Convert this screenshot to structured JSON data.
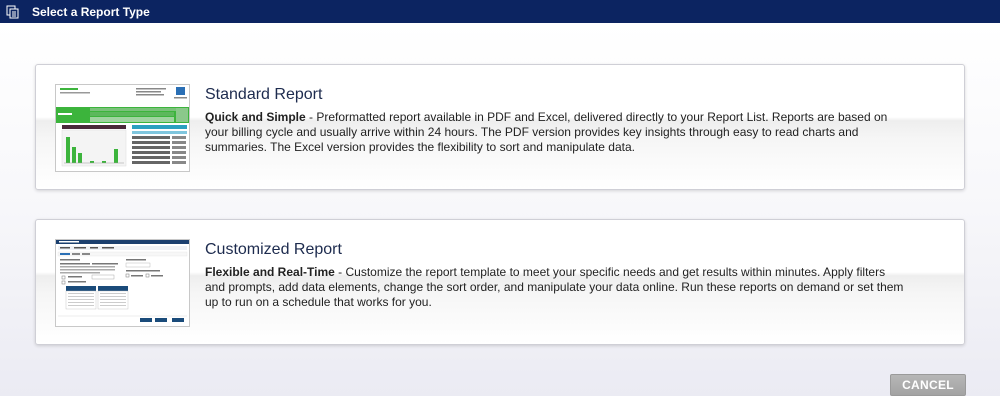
{
  "window": {
    "title": "Select a Report Type",
    "icon": "report-pages-icon"
  },
  "reports": [
    {
      "title": "Standard Report",
      "subtitle": "Quick and Simple",
      "description": " - Preformatted report available in PDF and Excel, delivered directly to your Report List. Reports are based on your billing cycle and usually arrive within 24 hours. The PDF version provides key insights through easy to read charts and summaries. The Excel version provides the flexibility to sort and manipulate data.",
      "thumbnail": "standard-report-preview"
    },
    {
      "title": "Customized Report",
      "subtitle": "Flexible and Real-Time",
      "description": " - Customize the report template to meet your specific needs and get results within minutes. Apply filters and prompts, add data elements, change the sort order, and manipulate your data online. Run these reports on demand or set them up to run on a schedule that works for you.",
      "thumbnail": "customized-report-preview"
    }
  ],
  "actions": {
    "cancel_label": "CANCEL"
  },
  "colors": {
    "titlebar": "#0c2461",
    "standard_thumb_green": "#3cb43c",
    "custom_thumb_blue": "#1a4b7a",
    "cancel_button": "#adadad"
  }
}
